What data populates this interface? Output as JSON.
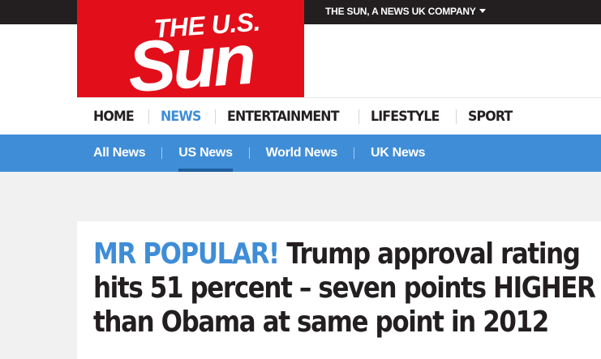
{
  "topbar": {
    "company_link": "THE SUN, A NEWS UK COMPANY",
    "background": "#231f20"
  },
  "logo": {
    "line1": "THE U.S.",
    "line2": "Sun",
    "background": "#e20f1a"
  },
  "primary_nav": {
    "items": [
      {
        "label": "HOME",
        "active": false
      },
      {
        "label": "NEWS",
        "active": true
      },
      {
        "label": "ENTERTAINMENT",
        "active": false
      },
      {
        "label": "LIFESTYLE",
        "active": false
      },
      {
        "label": "SPORT",
        "active": false
      }
    ]
  },
  "sub_nav": {
    "background": "#3f8dd7",
    "items": [
      {
        "label": "All News",
        "active": false
      },
      {
        "label": "US News",
        "active": true
      },
      {
        "label": "World News",
        "active": false
      },
      {
        "label": "UK News",
        "active": false
      }
    ]
  },
  "article": {
    "kicker": "MR POPULAR!",
    "headline": "Trump approval rating hits 51 percent – seven points HIGHER than Obama at same point in 2012"
  },
  "colors": {
    "accent_blue": "#3f8dd7",
    "brand_red": "#e20f1a",
    "text_dark": "#231f20",
    "page_background": "#f1f1f1"
  }
}
